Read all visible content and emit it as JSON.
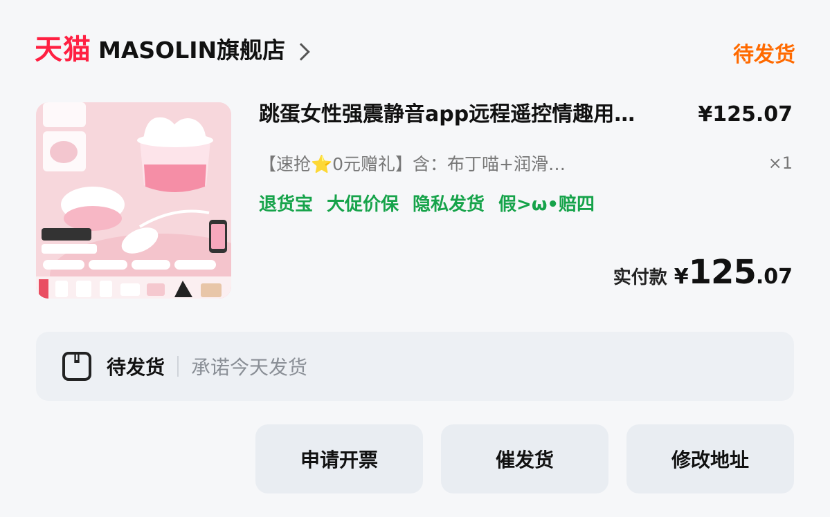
{
  "header": {
    "brand": "天猫",
    "store_name": "MASOLIN旗舰店",
    "order_status": "待发货"
  },
  "product": {
    "title": "跳蛋女性强震静音app远程遥控情趣用…",
    "price": "¥125.07",
    "spec": "【速抢⭐0元赠礼】含：布丁喵+润滑…",
    "quantity": "×1",
    "tags": [
      "退货宝",
      "大促价保",
      "隐私发货",
      "假>ω•赔四"
    ]
  },
  "payment": {
    "label": "实付款",
    "currency": "¥",
    "integer": "125",
    "decimal": ".07"
  },
  "shipping": {
    "status": "待发货",
    "note": "承诺今天发货"
  },
  "actions": {
    "invoice": "申请开票",
    "urge": "催发货",
    "edit_address": "修改地址"
  },
  "colors": {
    "brand_red": "#ff2042",
    "status_orange": "#ff6a00",
    "tag_green": "#16a34a"
  }
}
